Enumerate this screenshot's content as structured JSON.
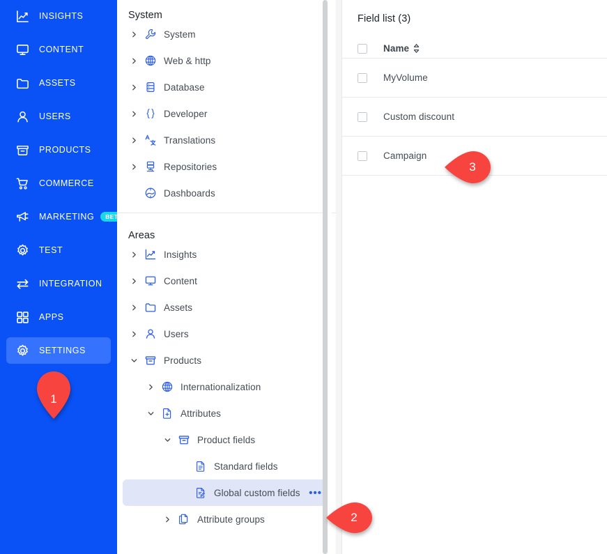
{
  "left_nav": {
    "items": [
      {
        "label": "INSIGHTS",
        "icon": "insights-chart-icon",
        "active": false,
        "badge": null
      },
      {
        "label": "CONTENT",
        "icon": "monitor-icon",
        "active": false,
        "badge": null
      },
      {
        "label": "ASSETS",
        "icon": "folder-icon",
        "active": false,
        "badge": null
      },
      {
        "label": "USERS",
        "icon": "user-icon",
        "active": false,
        "badge": null
      },
      {
        "label": "PRODUCTS",
        "icon": "box-icon",
        "active": false,
        "badge": null
      },
      {
        "label": "COMMERCE",
        "icon": "cart-icon",
        "active": false,
        "badge": null
      },
      {
        "label": "MARKETING",
        "icon": "megaphone-icon",
        "active": false,
        "badge": "BETA"
      },
      {
        "label": "TEST",
        "icon": "gear-icon",
        "active": false,
        "badge": null
      },
      {
        "label": "INTEGRATION",
        "icon": "exchange-arrows-icon",
        "active": false,
        "badge": null
      },
      {
        "label": "APPS",
        "icon": "grid-squares-icon",
        "active": false,
        "badge": null
      },
      {
        "label": "SETTINGS",
        "icon": "gear-icon",
        "active": true,
        "badge": null
      }
    ]
  },
  "tree_panel": {
    "sections": [
      {
        "title": "System",
        "items": [
          {
            "label": "System",
            "icon": "wrench-icon",
            "caret": "right",
            "indent": 0,
            "selected": false,
            "menu": false
          },
          {
            "label": "Web & http",
            "icon": "globe-icon",
            "caret": "right",
            "indent": 0,
            "selected": false,
            "menu": false
          },
          {
            "label": "Database",
            "icon": "database-icon",
            "caret": "right",
            "indent": 0,
            "selected": false,
            "menu": false
          },
          {
            "label": "Developer",
            "icon": "braces-icon",
            "caret": "right",
            "indent": 0,
            "selected": false,
            "menu": false
          },
          {
            "label": "Translations",
            "icon": "translate-icon",
            "caret": "right",
            "indent": 0,
            "selected": false,
            "menu": false
          },
          {
            "label": "Repositories",
            "icon": "repository-icon",
            "caret": "right",
            "indent": 0,
            "selected": false,
            "menu": false
          },
          {
            "label": "Dashboards",
            "icon": "dashboard-icon",
            "caret": "none",
            "indent": 0,
            "selected": false,
            "menu": false
          }
        ]
      },
      {
        "title": "Areas",
        "items": [
          {
            "label": "Insights",
            "icon": "insights-chart-icon",
            "caret": "right",
            "indent": 0,
            "selected": false,
            "menu": false
          },
          {
            "label": "Content",
            "icon": "monitor-icon",
            "caret": "right",
            "indent": 0,
            "selected": false,
            "menu": false
          },
          {
            "label": "Assets",
            "icon": "folder-icon",
            "caret": "right",
            "indent": 0,
            "selected": false,
            "menu": false
          },
          {
            "label": "Users",
            "icon": "user-icon",
            "caret": "right",
            "indent": 0,
            "selected": false,
            "menu": false
          },
          {
            "label": "Products",
            "icon": "box-icon",
            "caret": "down",
            "indent": 0,
            "selected": false,
            "menu": false
          },
          {
            "label": "Internationalization",
            "icon": "globe-icon",
            "caret": "right",
            "indent": 1,
            "selected": false,
            "menu": false
          },
          {
            "label": "Attributes",
            "icon": "doc-plus-icon",
            "caret": "down",
            "indent": 1,
            "selected": false,
            "menu": false
          },
          {
            "label": "Product fields",
            "icon": "box-icon",
            "caret": "down",
            "indent": 2,
            "selected": false,
            "menu": false
          },
          {
            "label": "Standard fields",
            "icon": "doc-lines-icon",
            "caret": "none",
            "indent": 3,
            "selected": false,
            "menu": false
          },
          {
            "label": "Global custom fields",
            "icon": "doc-edit-icon",
            "caret": "none",
            "indent": 3,
            "selected": true,
            "menu": true
          },
          {
            "label": "Attribute groups",
            "icon": "copy-docs-icon",
            "caret": "right",
            "indent": 2,
            "selected": false,
            "menu": false
          }
        ]
      }
    ],
    "row_menu_label": "•••"
  },
  "field_list": {
    "title": "Field list (3)",
    "columns": [
      "Name"
    ],
    "sort_icon": "sort-updown-icon",
    "rows": [
      {
        "name": "MyVolume",
        "checked": false
      },
      {
        "name": "Custom discount",
        "checked": false
      },
      {
        "name": "Campaign",
        "checked": false
      }
    ]
  },
  "markers": [
    {
      "id": "1",
      "label": "1"
    },
    {
      "id": "2",
      "label": "2"
    },
    {
      "id": "3",
      "label": "3"
    }
  ],
  "colors": {
    "nav_background": "#0a52f5",
    "nav_active": "#3573ff",
    "beta_badge": "#17d7e8",
    "tree_icon": "#2c5de5",
    "tree_selected": "#e0e6f7",
    "marker": "#f8443f",
    "divider": "#e6e8ea"
  }
}
